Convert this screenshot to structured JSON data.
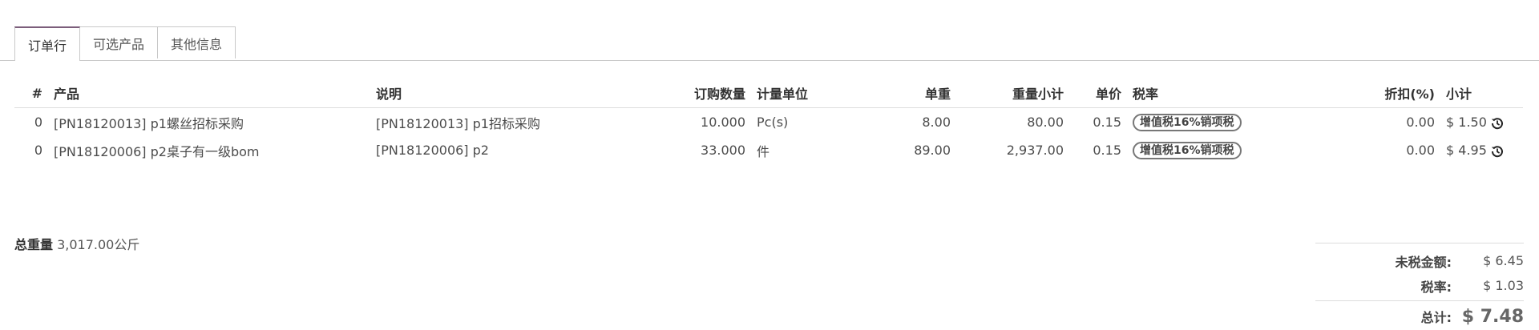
{
  "tabs": [
    "订单行",
    "可选产品",
    "其他信息"
  ],
  "columns": {
    "num": "#",
    "product": "产品",
    "description": "说明",
    "qty": "订购数量",
    "uom": "计量单位",
    "unit_weight": "单重",
    "weight_subtotal": "重量小计",
    "price": "单价",
    "tax": "税率",
    "discount": "折扣(%)",
    "subtotal": "小计"
  },
  "rows": [
    {
      "num": "0",
      "product": "[PN18120013] p1螺丝招标采购",
      "description": "[PN18120013] p1招标采购",
      "qty": "10.000",
      "uom": "Pc(s)",
      "unit_weight": "8.00",
      "weight_subtotal": "80.00",
      "price": "0.15",
      "tax": "增值税16%销项税",
      "discount": "0.00",
      "subtotal": "$ 1.50"
    },
    {
      "num": "0",
      "product": "[PN18120006] p2桌子有一级bom",
      "description": "[PN18120006] p2",
      "qty": "33.000",
      "uom": "件",
      "unit_weight": "89.00",
      "weight_subtotal": "2,937.00",
      "price": "0.15",
      "tax": "增值税16%销项税",
      "discount": "0.00",
      "subtotal": "$ 4.95"
    }
  ],
  "total_weight": {
    "label": "总重量",
    "value": "3,017.00公斤"
  },
  "totals": {
    "untaxed_label": "未税金额:",
    "untaxed_value": "$ 6.45",
    "tax_label": "税率:",
    "tax_value": "$ 1.03",
    "total_label": "总计:",
    "total_value": "$ 7.48"
  }
}
